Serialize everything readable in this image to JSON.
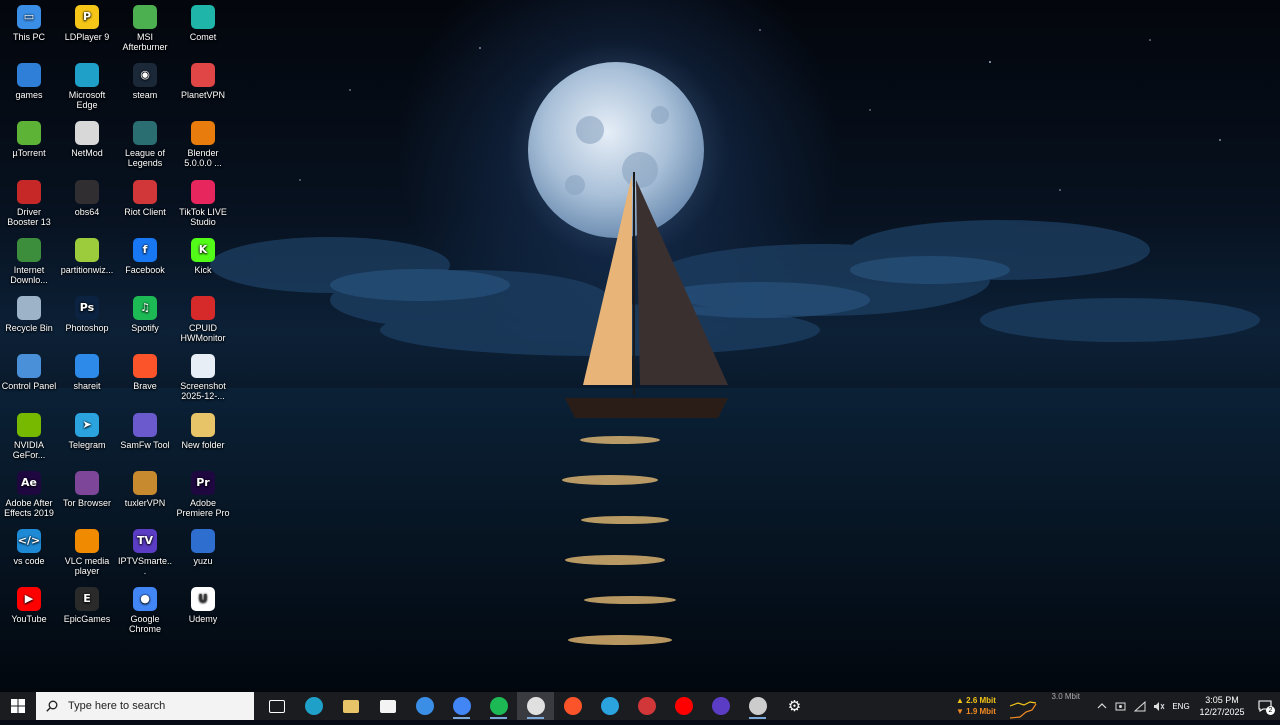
{
  "desktop": {
    "icons": [
      {
        "id": "this-pc",
        "label": "This PC",
        "glyph": "pc-icon",
        "color": "#3a8ee6"
      },
      {
        "id": "ldplayer",
        "label": "LDPlayer 9",
        "glyph": "ldplayer-icon",
        "color": "#f5c518"
      },
      {
        "id": "msi-afterburner",
        "label": "MSI Afterburner",
        "glyph": "afterburner-icon",
        "color": "#4caf50"
      },
      {
        "id": "comet",
        "label": "Comet",
        "glyph": "comet-icon",
        "color": "#1fb5a8"
      },
      {
        "id": "games",
        "label": "games",
        "glyph": "gamepad-icon",
        "color": "#2f7fd8"
      },
      {
        "id": "edge",
        "label": "Microsoft Edge",
        "glyph": "edge-icon",
        "color": "#1fa0c8"
      },
      {
        "id": "steam",
        "label": "steam",
        "glyph": "steam-icon",
        "color": "#1b2838"
      },
      {
        "id": "planetvpn",
        "label": "PlanetVPN",
        "glyph": "planetvpn-icon",
        "color": "#e04646"
      },
      {
        "id": "utorrent",
        "label": "µTorrent",
        "glyph": "utorrent-icon",
        "color": "#5cb335"
      },
      {
        "id": "netmod",
        "label": "NetMod",
        "glyph": "netmod-icon",
        "color": "#d8d8d8"
      },
      {
        "id": "league",
        "label": "League of Legends",
        "glyph": "league-icon",
        "color": "#2a6e72"
      },
      {
        "id": "blender",
        "label": "Blender 5.0.0.0 ...",
        "glyph": "blender-icon",
        "color": "#e87d0d"
      },
      {
        "id": "driver-booster",
        "label": "Driver Booster 13",
        "glyph": "driverbooster-icon",
        "color": "#c62828"
      },
      {
        "id": "obs",
        "label": "obs64",
        "glyph": "obs-icon",
        "color": "#302e31"
      },
      {
        "id": "riot",
        "label": "Riot Client",
        "glyph": "riot-icon",
        "color": "#d13639"
      },
      {
        "id": "tiktok-live",
        "label": "TikTok LIVE Studio",
        "glyph": "tiktok-icon",
        "color": "#e8265e"
      },
      {
        "id": "idm",
        "label": "Internet Downlo...",
        "glyph": "idm-icon",
        "color": "#3c8e3c"
      },
      {
        "id": "partitionwizard",
        "label": "partitionwiz...",
        "glyph": "partition-icon",
        "color": "#9ccc3c"
      },
      {
        "id": "facebook",
        "label": "Facebook",
        "glyph": "facebook-icon",
        "color": "#1877f2"
      },
      {
        "id": "kick",
        "label": "Kick",
        "glyph": "kick-icon",
        "color": "#53fc18"
      },
      {
        "id": "recycle-bin",
        "label": "Recycle Bin",
        "glyph": "recycle-bin-icon",
        "color": "#9db4c8"
      },
      {
        "id": "photoshop",
        "label": "Photoshop",
        "glyph": "photoshop-icon",
        "color": "#0b2240"
      },
      {
        "id": "spotify",
        "label": "Spotify",
        "glyph": "spotify-icon",
        "color": "#1db954"
      },
      {
        "id": "hwmonitor",
        "label": "CPUID HWMonitor",
        "glyph": "hwmonitor-icon",
        "color": "#d62a2a"
      },
      {
        "id": "control-panel",
        "label": "Control Panel",
        "glyph": "control-panel-icon",
        "color": "#4a90d9"
      },
      {
        "id": "shareit",
        "label": "shareit",
        "glyph": "shareit-icon",
        "color": "#2d8ae8"
      },
      {
        "id": "brave",
        "label": "Brave",
        "glyph": "brave-icon",
        "color": "#fb542b"
      },
      {
        "id": "screenshot",
        "label": "Screenshot 2025-12-...",
        "glyph": "image-file-icon",
        "color": "#e8eef5"
      },
      {
        "id": "nvidia",
        "label": "NVIDIA GeFor...",
        "glyph": "nvidia-icon",
        "color": "#76b900"
      },
      {
        "id": "telegram",
        "label": "Telegram",
        "glyph": "telegram-icon",
        "color": "#2aa3df"
      },
      {
        "id": "samfw",
        "label": "SamFw Tool",
        "glyph": "samfw-icon",
        "color": "#6a5acd"
      },
      {
        "id": "new-folder",
        "label": "New folder",
        "glyph": "folder-icon",
        "color": "#e8c468"
      },
      {
        "id": "after-effects",
        "label": "Adobe After Effects 2019",
        "glyph": "after-effects-icon",
        "color": "#1f0740"
      },
      {
        "id": "tor",
        "label": "Tor Browser",
        "glyph": "tor-icon",
        "color": "#7d4698"
      },
      {
        "id": "tuxlervpn",
        "label": "tuxlerVPN",
        "glyph": "tuxler-icon",
        "color": "#c88a2e"
      },
      {
        "id": "premiere",
        "label": "Adobe Premiere Pro",
        "glyph": "premiere-icon",
        "color": "#1f0740"
      },
      {
        "id": "vscode",
        "label": "vs code",
        "glyph": "vscode-icon",
        "color": "#1e8ad6"
      },
      {
        "id": "vlc",
        "label": "VLC media player",
        "glyph": "vlc-icon",
        "color": "#f08a00"
      },
      {
        "id": "iptv",
        "label": "IPTVSmarte...",
        "glyph": "iptv-icon",
        "color": "#5b3cc4"
      },
      {
        "id": "yuzu",
        "label": "yuzu",
        "glyph": "yuzu-icon",
        "color": "#2e6ecf"
      },
      {
        "id": "youtube",
        "label": "YouTube",
        "glyph": "youtube-icon",
        "color": "#ff0000"
      },
      {
        "id": "epic",
        "label": "EpicGames",
        "glyph": "epic-games-icon",
        "color": "#2a2a2a"
      },
      {
        "id": "chrome",
        "label": "Google Chrome",
        "glyph": "chrome-icon",
        "color": "#4285f4"
      },
      {
        "id": "udemy",
        "label": "Udemy",
        "glyph": "udemy-icon",
        "color": "#ffffff"
      }
    ]
  },
  "taskbar": {
    "search_placeholder": "Type here to search",
    "apps": [
      {
        "id": "task-view",
        "glyph": "task-view-icon",
        "color": "#ffffff",
        "running": false
      },
      {
        "id": "edge",
        "glyph": "edge-icon",
        "color": "#1fa0c8",
        "running": false
      },
      {
        "id": "file-explorer",
        "glyph": "folder-icon",
        "color": "#e8c468",
        "running": false
      },
      {
        "id": "store",
        "glyph": "store-icon",
        "color": "#f3f3f3",
        "running": false
      },
      {
        "id": "steam",
        "glyph": "steam-icon",
        "color": "#3a8ee6",
        "running": false
      },
      {
        "id": "chrome",
        "glyph": "chrome-icon",
        "color": "#4285f4",
        "running": true
      },
      {
        "id": "spotify",
        "glyph": "spotify-icon",
        "color": "#1db954",
        "running": true
      },
      {
        "id": "chatgpt",
        "glyph": "chatgpt-icon",
        "color": "#e0e0e0",
        "running": true,
        "active": true
      },
      {
        "id": "brave",
        "glyph": "brave-icon",
        "color": "#fb542b",
        "running": false
      },
      {
        "id": "telegram",
        "glyph": "telegram-icon",
        "color": "#2aa3df",
        "running": false
      },
      {
        "id": "riot",
        "glyph": "riot-icon",
        "color": "#d13639",
        "running": false
      },
      {
        "id": "youtube",
        "glyph": "youtube-icon",
        "color": "#ff0000",
        "running": false
      },
      {
        "id": "iptv",
        "glyph": "iptv-icon",
        "color": "#5b3cc4",
        "running": false
      },
      {
        "id": "obs",
        "glyph": "obs-icon",
        "color": "#cccccc",
        "running": true
      },
      {
        "id": "settings",
        "glyph": "gear-icon",
        "color": "#ffffff",
        "running": false
      }
    ],
    "tray": {
      "net_up": "▲ 2.6 Mbit",
      "net_down": "▼ 1.9 Mbit",
      "net_max": "3.0 Mbit",
      "language": "ENG",
      "time": "3:05 PM",
      "date": "12/27/2025",
      "notification_count": "2"
    }
  }
}
